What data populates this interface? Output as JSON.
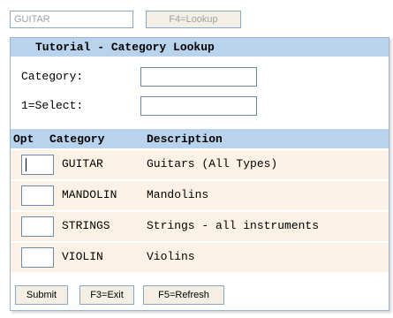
{
  "top": {
    "input_value": "GUITAR",
    "lookup_button": "F4=Lookup"
  },
  "panel": {
    "title": "Tutorial - Category Lookup",
    "fields": {
      "category_label": "Category:",
      "category_value": "",
      "select_label": "1=Select:",
      "select_value": ""
    },
    "table": {
      "headers": [
        "Opt",
        "Category",
        "Description"
      ],
      "rows": [
        {
          "opt": "",
          "category": "GUITAR",
          "description": "Guitars (All Types)"
        },
        {
          "opt": "",
          "category": "MANDOLIN",
          "description": "Mandolins"
        },
        {
          "opt": "",
          "category": "STRINGS",
          "description": "Strings - all instruments"
        },
        {
          "opt": "",
          "category": "VIOLIN",
          "description": "Violins"
        }
      ]
    },
    "buttons": {
      "submit": "Submit",
      "exit": "F3=Exit",
      "refresh": "F5=Refresh"
    }
  },
  "colors": {
    "header_bg": "#b9d3ec",
    "row_alt_bg": "#fbf1e4",
    "button_bg": "#f3efe4",
    "border": "#8aa6c8"
  }
}
